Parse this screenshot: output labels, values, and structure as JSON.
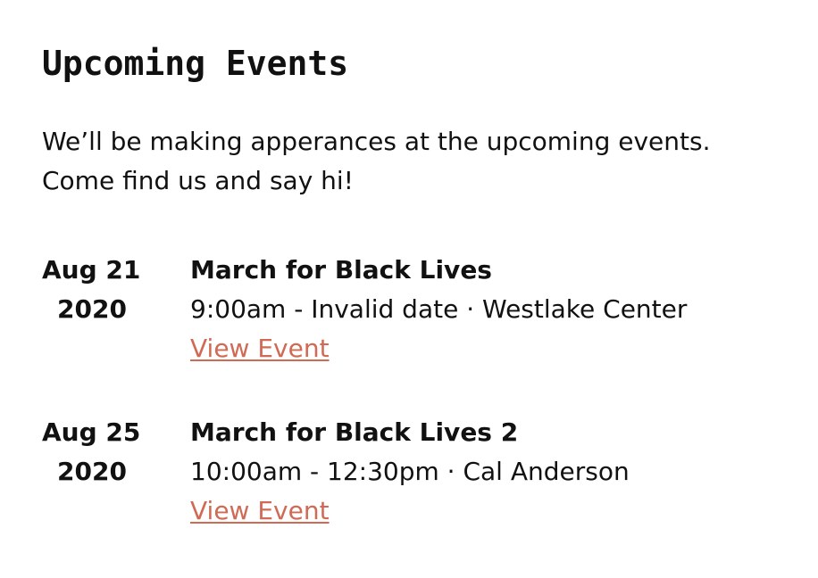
{
  "page": {
    "heading": "Upcoming Events",
    "intro": "We’ll be making apperances at the upcoming events. Come find us and say hi!",
    "link_color": "#d06a55"
  },
  "events": [
    {
      "date": "Aug 21",
      "year": "2020",
      "title": "March for Black Lives",
      "meta": "9:00am - Invalid date · Westlake Center",
      "link_label": "View Event"
    },
    {
      "date": "Aug 25",
      "year": "2020",
      "title": "March for Black Lives 2",
      "meta": "10:00am - 12:30pm · Cal Anderson",
      "link_label": "View Event"
    }
  ]
}
